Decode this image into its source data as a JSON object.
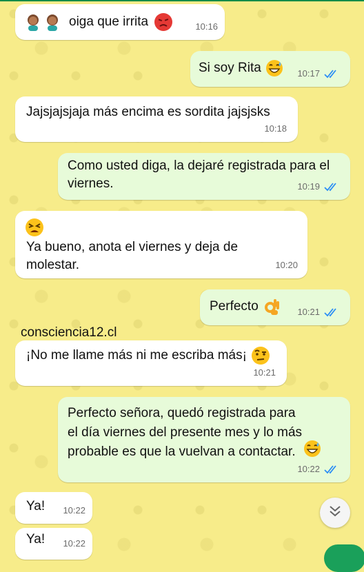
{
  "messages": [
    {
      "dir": "in",
      "text": "oiga que irrita",
      "time": "10:16"
    },
    {
      "dir": "out",
      "text": "Si soy Rita",
      "time": "10:17"
    },
    {
      "dir": "in",
      "text": "Jajsjajsjaja más encima es sordita jajsjsks",
      "time": "10:18"
    },
    {
      "dir": "out",
      "text": "Como usted diga, la dejaré registrada para el viernes.",
      "time": "10:19"
    },
    {
      "dir": "in",
      "text": "Ya bueno, anota el viernes y deja de molestar.",
      "time": "10:20"
    },
    {
      "dir": "out",
      "text": "Perfecto",
      "time": "10:21"
    },
    {
      "dir": "in",
      "text": "¡No me llame más ni me escriba más¡",
      "time": "10:21"
    },
    {
      "dir": "out",
      "text": "Perfecto señora, quedó registrada para el día viernes del presente mes y lo más probable es que la vuelvan a contactar.",
      "time": "10:22"
    },
    {
      "dir": "in",
      "text": "Ya!",
      "time": "10:22"
    },
    {
      "dir": "in",
      "text": "Ya!",
      "time": "10:22"
    }
  ],
  "watermark": "consciencia12.cl",
  "icons": {
    "read": "double-check-icon",
    "scroll": "chevron-double-down-icon"
  },
  "colors": {
    "background": "#f7ec8a",
    "incoming": "#ffffff",
    "outgoing": "#e7fbd9",
    "ticks": "#2b8ef5"
  }
}
